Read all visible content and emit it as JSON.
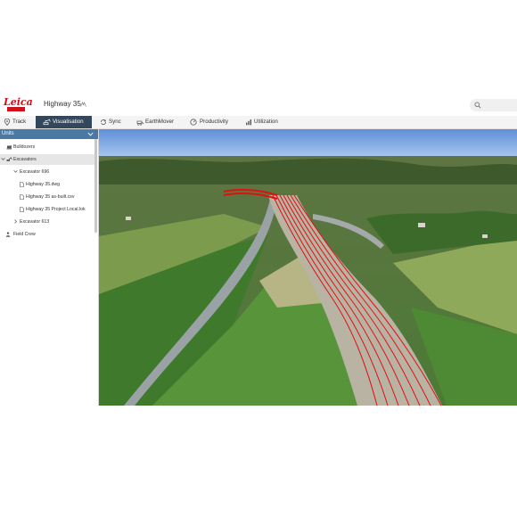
{
  "app": {
    "brand": "Leica",
    "brand_sub": "Geosystems",
    "project_title": "Highway 35"
  },
  "search": {
    "placeholder": ""
  },
  "nav": {
    "tabs": [
      {
        "label": "Track"
      },
      {
        "label": "Visualisation"
      },
      {
        "label": "Sync"
      },
      {
        "label": "EarthMover"
      },
      {
        "label": "Productivity"
      },
      {
        "label": "Utilization"
      }
    ],
    "active": "Visualisation"
  },
  "sidebar": {
    "header": "Units",
    "items": [
      {
        "label": "Bulldozers"
      },
      {
        "label": "Excavators"
      },
      {
        "label": "Excavator 696"
      },
      {
        "label": "Highway 35.dwg"
      },
      {
        "label": "Highway 35 as-built.csv"
      },
      {
        "label": "Highway 35 Project Local.lok"
      },
      {
        "label": "Excavator 613"
      },
      {
        "label": "Field Crew"
      }
    ]
  },
  "colors": {
    "accent": "#34465a",
    "units_header": "#4a79a6",
    "brand_red": "#d0101b",
    "design_lines": "#e01010"
  },
  "viewport": {
    "content": "3d-terrain-highway-view"
  }
}
